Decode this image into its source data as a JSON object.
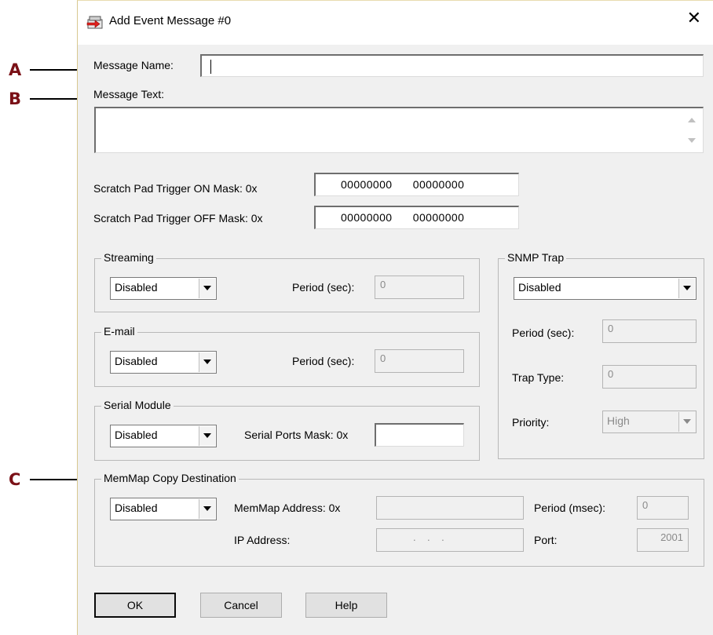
{
  "callouts": [
    "A",
    "B",
    "C"
  ],
  "dialog": {
    "title": "Add Event Message #0",
    "close_glyph": "✕",
    "icon": "add-event-message-icon"
  },
  "message": {
    "name_label": "Message Name:",
    "name_value": "",
    "text_label": "Message Text:",
    "text_value": ""
  },
  "scratch_pad": {
    "on_label": "Scratch Pad Trigger ON Mask:  0x",
    "on_value": "00000000 00000000",
    "off_label": "Scratch Pad Trigger OFF Mask: 0x",
    "off_value": "00000000 00000000"
  },
  "streaming": {
    "title": "Streaming",
    "mode": "Disabled",
    "period_label": "Period (sec):",
    "period_value": "0"
  },
  "email": {
    "title": "E-mail",
    "mode": "Disabled",
    "period_label": "Period (sec):",
    "period_value": "0"
  },
  "serial": {
    "title": "Serial Module",
    "mode": "Disabled",
    "mask_label": "Serial Ports Mask: 0x",
    "mask_value": ""
  },
  "snmp": {
    "title": "SNMP Trap",
    "mode": "Disabled",
    "period_label": "Period (sec):",
    "period_value": "0",
    "trap_type_label": "Trap Type:",
    "trap_type_value": "0",
    "priority_label": "Priority:",
    "priority_value": "High"
  },
  "memmap": {
    "title": "MemMap Copy Destination",
    "mode": "Disabled",
    "address_label": "MemMap Address: 0x",
    "address_value": "",
    "period_label": "Period (msec):",
    "period_value": "0",
    "ip_label": "IP Address:",
    "ip_value": ".    .    .",
    "port_label": "Port:",
    "port_value": "2001"
  },
  "buttons": {
    "ok": "OK",
    "cancel": "Cancel",
    "help": "Help"
  },
  "colors": {
    "callout": "#7a1016",
    "dialog_bg": "#f0f0f0"
  }
}
